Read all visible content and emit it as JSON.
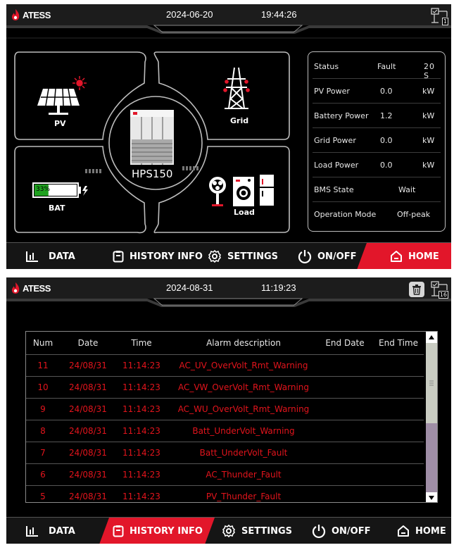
{
  "brand": "ATESS",
  "colors": {
    "accent": "#e2162a",
    "alarm_text": "#e2141c",
    "battery_fill": "#1fa11f"
  },
  "screen1": {
    "date": "2024-06-20",
    "time": "19:44:26",
    "net_count": "1",
    "diagram": {
      "pv_label": "PV",
      "grid_label": "Grid",
      "bat_label": "BAT",
      "load_label": "Load",
      "center_label": "HPS150",
      "battery_percent": "33%",
      "battery_level": 0.33
    },
    "status": [
      {
        "label": "Status",
        "value": "Fault",
        "extra": "20 S"
      },
      {
        "label": "PV Power",
        "value": "0.0",
        "unit": "kW"
      },
      {
        "label": "Battery Power",
        "value": "1.2",
        "unit": "kW"
      },
      {
        "label": "Grid Power",
        "value": "0.0",
        "unit": "kW"
      },
      {
        "label": "Load Power",
        "value": "0.0",
        "unit": "kW"
      },
      {
        "label": "BMS State",
        "value": "Wait"
      },
      {
        "label": "Operation Mode",
        "value": "Off-peak"
      }
    ]
  },
  "screen2": {
    "date": "2024-08-31",
    "time": "11:19:23",
    "net_count": "16",
    "columns": [
      "Num",
      "Date",
      "Time",
      "Alarm description",
      "End Date",
      "End Time"
    ],
    "rows": [
      {
        "num": "11",
        "date": "24/08/31",
        "time": "11:14:23",
        "desc": "AC_UV_OverVolt_Rmt_Warning"
      },
      {
        "num": "10",
        "date": "24/08/31",
        "time": "11:14:23",
        "desc": "AC_VW_OverVolt_Rmt_Warning"
      },
      {
        "num": "9",
        "date": "24/08/31",
        "time": "11:14:23",
        "desc": "AC_WU_OverVolt_Rmt_Warning"
      },
      {
        "num": "8",
        "date": "24/08/31",
        "time": "11:14:23",
        "desc": "Batt_UnderVolt_Warning"
      },
      {
        "num": "7",
        "date": "24/08/31",
        "time": "11:14:23",
        "desc": "Batt_UnderVolt_Fault"
      },
      {
        "num": "6",
        "date": "24/08/31",
        "time": "11:14:23",
        "desc": "AC_Thunder_Fault"
      },
      {
        "num": "5",
        "date": "24/08/31",
        "time": "11:14:23",
        "desc": "PV_Thunder_Fault"
      }
    ]
  },
  "nav": {
    "data": "DATA",
    "history": "HISTORY INFO",
    "settings": "SETTINGS",
    "onoff": "ON/OFF",
    "home": "HOME"
  }
}
